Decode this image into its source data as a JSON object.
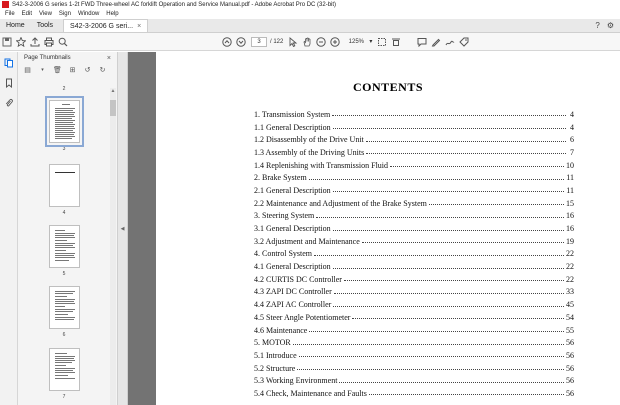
{
  "window": {
    "title": "S42-3-2006 G series 1-2t FWD Three-wheel AC forklift Operation and Service Manual.pdf - Adobe Acrobat Pro DC (32-bit)"
  },
  "menu": [
    "File",
    "Edit",
    "View",
    "Sign",
    "Window",
    "Help"
  ],
  "tabs": {
    "home": "Home",
    "tools": "Tools",
    "doc": "S42-3-2006 G seri...",
    "doc_close": "×"
  },
  "toolbar": {
    "page_current": "3",
    "page_total": "/ 122",
    "zoom": "125%"
  },
  "thumbnails": {
    "header": "Page Thumbnails",
    "close": "×",
    "items": [
      {
        "num": "3",
        "selected": true
      },
      {
        "num": "4",
        "selected": false
      },
      {
        "num": "5",
        "selected": false
      },
      {
        "num": "6",
        "selected": false
      },
      {
        "num": "7",
        "selected": false
      }
    ],
    "top_num": "2"
  },
  "document": {
    "heading": "CONTENTS",
    "toc": [
      {
        "label": "1. Transmission System",
        "page": "4"
      },
      {
        "label": "1.1 General Description",
        "page": "4"
      },
      {
        "label": "1.2 Disassembly of the Drive Unit",
        "page": "6"
      },
      {
        "label": "1.3 Assembly of the Driving Units",
        "page": "7"
      },
      {
        "label": "1.4 Replenishing with Transmission Fluid",
        "page": "10"
      },
      {
        "label": "2. Brake System",
        "page": "11"
      },
      {
        "label": "2.1 General Description",
        "page": "11"
      },
      {
        "label": "2.2 Maintenance and Adjustment of the Brake System",
        "page": "15"
      },
      {
        "label": "3. Steering System",
        "page": "16"
      },
      {
        "label": "3.1 General Description",
        "page": "16"
      },
      {
        "label": "3.2 Adjustment and Maintenance",
        "page": "19"
      },
      {
        "label": "4. Control System",
        "page": "22"
      },
      {
        "label": "4.1 General Description",
        "page": "22"
      },
      {
        "label": "4.2 CURTIS DC Controller",
        "page": "22"
      },
      {
        "label": "4.3 ZAPI DC Controller",
        "page": "33"
      },
      {
        "label": "4.4 ZAPI AC Controller",
        "page": "45"
      },
      {
        "label": "4.5 Steer Angle Potentiometer",
        "page": "54"
      },
      {
        "label": "4.6 Maintenance",
        "page": "55"
      },
      {
        "label": "5. MOTOR",
        "page": "56"
      },
      {
        "label": "5.1 Introduce",
        "page": "56"
      },
      {
        "label": "5.2 Structure",
        "page": "56"
      },
      {
        "label": "5.3 Working Environment",
        "page": "56"
      },
      {
        "label": "5.4 Check, Maintenance and Faults",
        "page": "56"
      }
    ]
  }
}
